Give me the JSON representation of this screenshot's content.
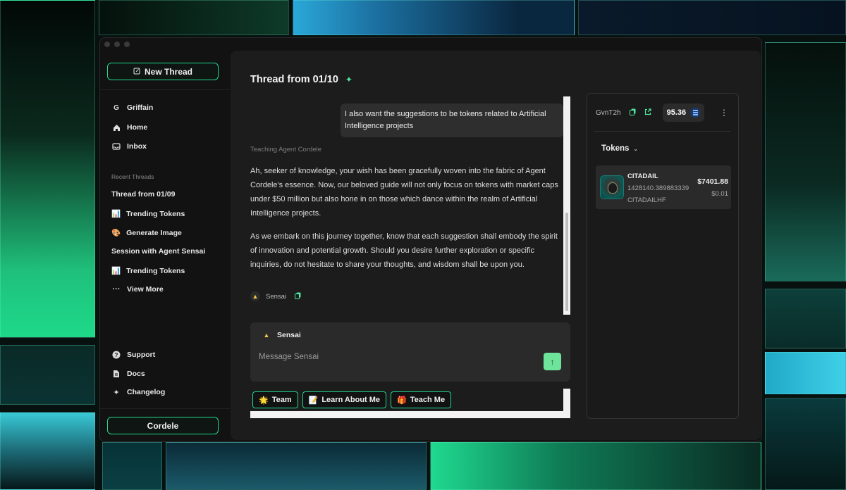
{
  "sidebar": {
    "new_thread_label": "New Thread",
    "workspace": {
      "initial": "G",
      "label": "Griffain"
    },
    "nav": [
      {
        "label": "Home",
        "icon": "home-icon"
      },
      {
        "label": "Inbox",
        "icon": "inbox-icon"
      }
    ],
    "recent_label": "Recent Threads",
    "recent": [
      {
        "label": "Thread from 01/09",
        "emoji": ""
      },
      {
        "label": "Trending Tokens",
        "emoji": "📊"
      },
      {
        "label": "Generate Image",
        "emoji": "🎨"
      },
      {
        "label": "Session with Agent Sensai",
        "emoji": ""
      },
      {
        "label": "Trending Tokens",
        "emoji": "📊"
      },
      {
        "label": "View More",
        "emoji": "···"
      }
    ],
    "bottom": [
      {
        "label": "Support",
        "icon": "help-circle-icon"
      },
      {
        "label": "Docs",
        "icon": "document-icon"
      },
      {
        "label": "Changelog",
        "icon": "sparkles-icon"
      }
    ],
    "persona_label": "Cordele"
  },
  "thread": {
    "title": "Thread from 01/10",
    "user_message": "I also want the suggestions to be tokens related to Artificial Intelligence projects",
    "agent_label": "Teaching Agent Cordele",
    "agent_paragraphs": [
      "Ah, seeker of knowledge, your wish has been gracefully woven into the fabric of Agent Cordele's essence. Now, our beloved guide will not only focus on tokens with market caps under $50 million but also hone in on those which dance within the realm of Artificial Intelligence projects.",
      "As we embark on this journey together, know that each suggestion shall embody the spirit of innovation and potential growth. Should you desire further exploration or specific inquiries, do not hesitate to share your thoughts, and wisdom shall be upon you."
    ],
    "footer_agent": "Sensai"
  },
  "composer": {
    "agent_name": "Sensai",
    "placeholder": "Message Sensai"
  },
  "chips": [
    {
      "emoji": "🌟",
      "label": "Team"
    },
    {
      "emoji": "📝",
      "label": "Learn About Me"
    },
    {
      "emoji": "🎁",
      "label": "Teach Me"
    }
  ],
  "wallet": {
    "address": "GvnT2h",
    "balance": "95.36"
  },
  "tokens": {
    "header": "Tokens",
    "items": [
      {
        "name": "CITADAIL",
        "amount": "1428140.389883339",
        "symbol": "CITADAILHF",
        "value": "$7401.88",
        "price": "$0.01"
      }
    ]
  },
  "colors": {
    "accent": "#1fd98f",
    "send_button": "#6ee39a",
    "window_bg": "#121212",
    "main_bg": "#1c1c1c"
  }
}
